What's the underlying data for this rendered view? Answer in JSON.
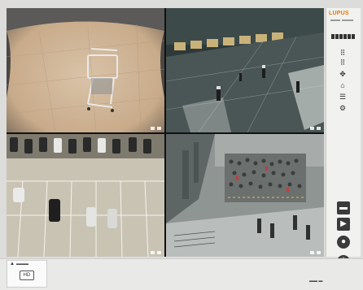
{
  "app": {
    "brand": "LUPUS"
  },
  "layout_buttons": [
    "layout-1",
    "layout-2",
    "layout-3",
    "layout-4",
    "layout-5",
    "layout-6"
  ],
  "sidebar": {
    "icons": [
      {
        "name": "grid-4-icon",
        "glyph": "⠿"
      },
      {
        "name": "grid-9-icon",
        "glyph": "⠿"
      },
      {
        "name": "ptz-icon",
        "glyph": "✥"
      },
      {
        "name": "home-icon",
        "glyph": "⌂"
      },
      {
        "name": "list-icon",
        "glyph": "☰"
      },
      {
        "name": "settings-icon",
        "glyph": "⚙"
      }
    ],
    "actions": [
      {
        "name": "snapshot-button",
        "glyph": "▬"
      },
      {
        "name": "playback-button",
        "glyph": "▶"
      },
      {
        "name": "record-button",
        "glyph": "●"
      },
      {
        "name": "power-button",
        "glyph": "⏻"
      }
    ]
  },
  "footer": {
    "camera_quality": "HD"
  },
  "colors": {
    "accent": "#e07a10",
    "sidebar_bg": "#f1f1ef",
    "button": "#3a3a3a"
  }
}
